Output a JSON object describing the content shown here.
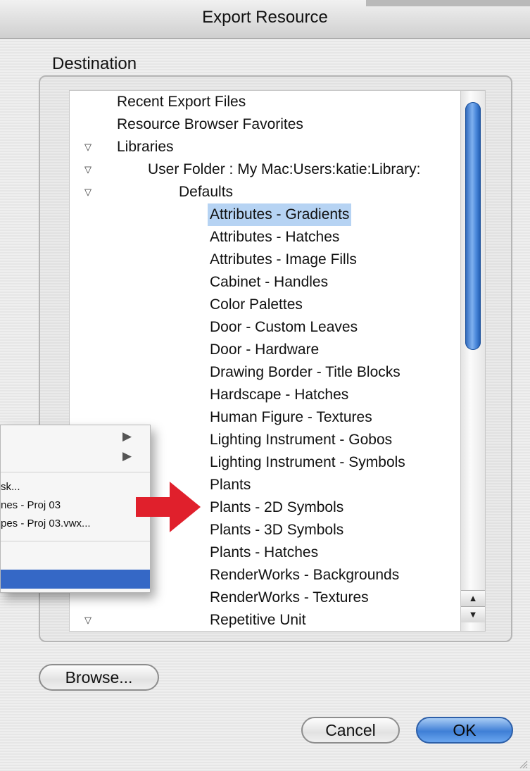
{
  "window": {
    "title": "Export Resource"
  },
  "destination_label": "Destination",
  "tree": [
    {
      "label": "Recent Export Files",
      "disclosure": "",
      "indent": 0,
      "selected": false
    },
    {
      "label": "Resource Browser Favorites",
      "disclosure": "",
      "indent": 0,
      "selected": false
    },
    {
      "label": "Libraries",
      "disclosure": "open",
      "indent": 0,
      "selected": false
    },
    {
      "label": "User Folder : My Mac:Users:katie:Library:",
      "disclosure": "open",
      "indent": 1,
      "selected": false
    },
    {
      "label": "Defaults",
      "disclosure": "open",
      "indent": 2,
      "selected": false
    },
    {
      "label": "Attributes - Gradients",
      "disclosure": "",
      "indent": 3,
      "selected": true
    },
    {
      "label": "Attributes - Hatches",
      "disclosure": "",
      "indent": 3,
      "selected": false
    },
    {
      "label": "Attributes - Image Fills",
      "disclosure": "",
      "indent": 3,
      "selected": false
    },
    {
      "label": "Cabinet - Handles",
      "disclosure": "",
      "indent": 3,
      "selected": false
    },
    {
      "label": "Color Palettes",
      "disclosure": "",
      "indent": 3,
      "selected": false
    },
    {
      "label": "Door - Custom Leaves",
      "disclosure": "",
      "indent": 3,
      "selected": false
    },
    {
      "label": "Door - Hardware",
      "disclosure": "",
      "indent": 3,
      "selected": false
    },
    {
      "label": "Drawing Border - Title Blocks",
      "disclosure": "",
      "indent": 3,
      "selected": false
    },
    {
      "label": "Hardscape - Hatches",
      "disclosure": "",
      "indent": 3,
      "selected": false
    },
    {
      "label": "Human Figure - Textures",
      "disclosure": "",
      "indent": 3,
      "selected": false
    },
    {
      "label": "Lighting Instrument - Gobos",
      "disclosure": "",
      "indent": 3,
      "selected": false
    },
    {
      "label": "Lighting Instrument - Symbols",
      "disclosure": "",
      "indent": 3,
      "selected": false
    },
    {
      "label": "Plants",
      "disclosure": "",
      "indent": 3,
      "selected": false
    },
    {
      "label": "Plants - 2D Symbols",
      "disclosure": "",
      "indent": 3,
      "selected": false
    },
    {
      "label": "Plants - 3D Symbols",
      "disclosure": "",
      "indent": 3,
      "selected": false
    },
    {
      "label": "Plants - Hatches",
      "disclosure": "",
      "indent": 3,
      "selected": false
    },
    {
      "label": "RenderWorks - Backgrounds",
      "disclosure": "",
      "indent": 3,
      "selected": false
    },
    {
      "label": "RenderWorks - Textures",
      "disclosure": "",
      "indent": 3,
      "selected": false
    },
    {
      "label": "Repetitive Unit",
      "disclosure": "open",
      "indent": 3,
      "selected": false
    }
  ],
  "popup_menu": {
    "items": [
      {
        "label": "sk...",
        "row": 0
      },
      {
        "label": "nes - Proj 03",
        "row": 1
      },
      {
        "label": "pes - Proj 03.vwx...",
        "row": 2
      }
    ],
    "submenu_arrows": 2
  },
  "scrollbar": {
    "up": "▲",
    "down": "▼"
  },
  "icons": {
    "disclosure_open": "▽",
    "submenu": "▶"
  },
  "colors": {
    "selection": "#b6d3f3",
    "accent": "#3568c6",
    "arrow": "#e0202c"
  },
  "buttons": {
    "browse": "Browse...",
    "cancel": "Cancel",
    "ok": "OK"
  }
}
